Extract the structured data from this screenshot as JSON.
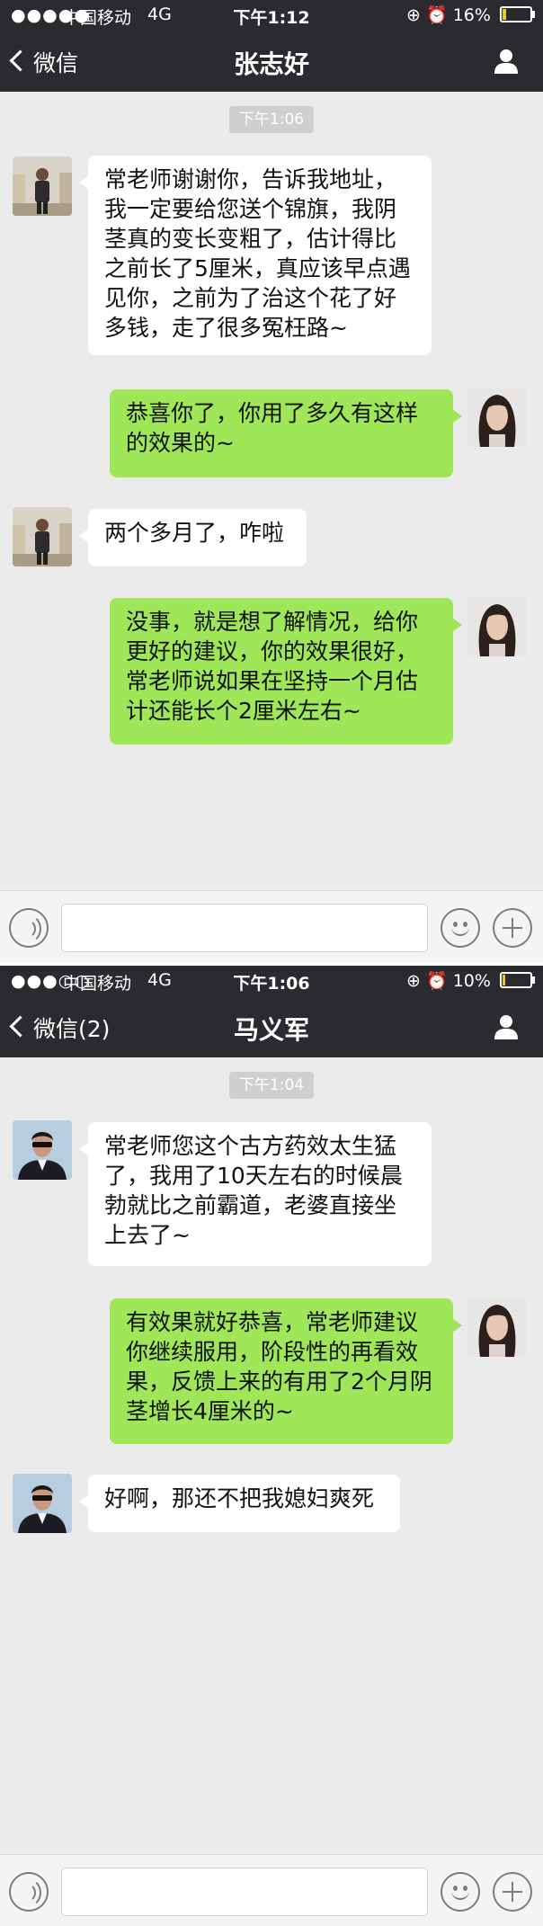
{
  "screens": [
    {
      "status": {
        "signal": "●●●●●",
        "carrier": "中国移动",
        "network": "4G",
        "time": "下午1:12",
        "icons": "⊕ ⏰",
        "battery": "16%",
        "battery_level": 0.16
      },
      "nav": {
        "back_label": "微信",
        "title": "张志好"
      },
      "timestamp": "下午1:06",
      "messages": [
        {
          "side": "in",
          "avatar": "man-avatar",
          "text": "常老师谢谢你，告诉我地址，我一定要给您送个锦旗，我阴茎真的变长变粗了，估计得比之前长了5厘米，真应该早点遇见你，之前为了治这个花了好多钱，走了很多冤枉路~"
        },
        {
          "side": "out",
          "avatar": "woman-avatar",
          "text": "恭喜你了，你用了多久有这样的效果的~"
        },
        {
          "side": "in",
          "avatar": "man-avatar",
          "text": "两个多月了，咋啦"
        },
        {
          "side": "out",
          "avatar": "woman-avatar",
          "text": "没事，就是想了解情况，给你更好的建议，你的效果很好，常老师说如果在坚持一个月估计还能长个2厘米左右~"
        }
      ]
    },
    {
      "status": {
        "signal": "●●●○○",
        "carrier": "中国移动",
        "network": "4G",
        "time": "下午1:06",
        "icons": "⊕ ⏰",
        "battery": "10%",
        "battery_level": 0.1
      },
      "nav": {
        "back_label": "微信(2)",
        "title": "马义军"
      },
      "timestamp": "下午1:04",
      "messages": [
        {
          "side": "in",
          "avatar": "man-avatar",
          "text": "常老师您这个古方药效太生猛了，我用了10天左右的时候晨勃就比之前霸道，老婆直接坐上去了~"
        },
        {
          "side": "out",
          "avatar": "woman-avatar",
          "text": "有效果就好恭喜，常老师建议你继续服用，阶段性的再看效果，反馈上来的有用了2个月阴茎增长4厘米的~"
        },
        {
          "side": "in",
          "avatar": "man-avatar",
          "text": "好啊，那还不把我媳妇爽死"
        }
      ]
    }
  ]
}
